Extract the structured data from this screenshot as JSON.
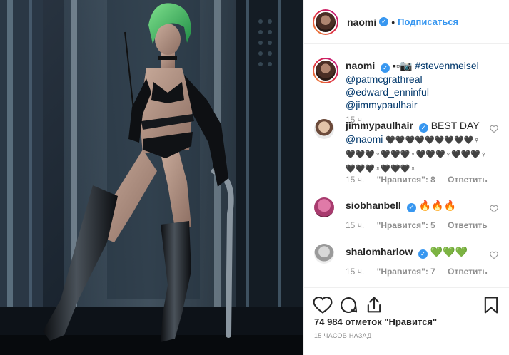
{
  "header": {
    "username": "naomi",
    "separator": "•",
    "follow_label": "Подписаться"
  },
  "caption": {
    "username": "naomi",
    "symbols": "▪▫📷",
    "hashtag": "#stevenmeisel",
    "mentions_line1": "@patmcgrathreal @edward_enninful",
    "mentions_line2": "@jimmypaulhair",
    "age": "15 ч."
  },
  "comments": [
    {
      "username": "jimmypaulhair",
      "text": "BEST DAY",
      "mention": "@naomi",
      "text2": "🖤🖤🖤🖤🖤🖤🖤🖤🖤♀",
      "text3": "🖤🖤🖤♀🖤🖤🖤♀🖤🖤🖤♀🖤🖤🖤♀",
      "text4": "🖤🖤🖤♀🖤🖤🖤♀",
      "age": "15 ч.",
      "likes": "\"Нравится\": 8",
      "reply": "Ответить"
    },
    {
      "username": "siobhanbell",
      "text": "🔥🔥🔥",
      "age": "15 ч.",
      "likes": "\"Нравится\": 5",
      "reply": "Ответить"
    },
    {
      "username": "shalomharlow",
      "text": "💚💚💚",
      "age": "15 ч.",
      "likes": "\"Нравится\": 7",
      "reply": "Ответить"
    }
  ],
  "footer": {
    "likes_text": "74 984 отметок \"Нравится\"",
    "timestamp": "15 ЧАСОВ НАЗАД"
  },
  "icons": {
    "like": "heart-icon",
    "comment": "comment-icon",
    "share": "share-icon",
    "save": "bookmark-icon",
    "verified": "verified-badge-icon"
  },
  "colors": {
    "link_blue": "#3897f0",
    "mention_blue": "#00376b",
    "verified_blue": "#3897f0",
    "muted": "#8e8e8e",
    "text": "#262626"
  }
}
